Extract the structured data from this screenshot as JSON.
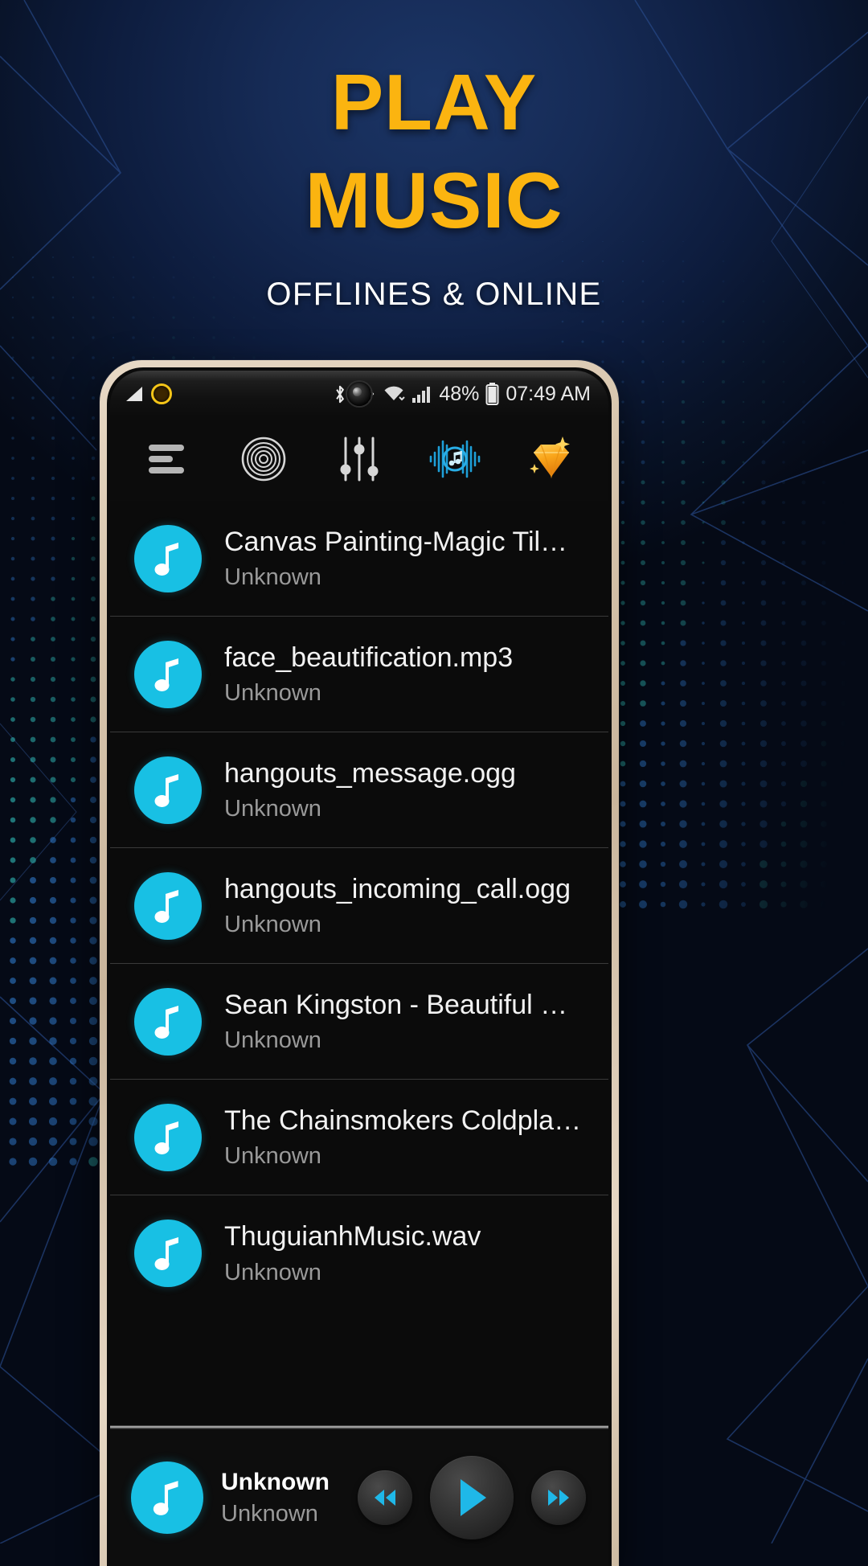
{
  "promo": {
    "headline_line1": "PLAY",
    "headline_line2": "MUSIC",
    "subtitle": "OFFLINES & ONLINE",
    "headline_color": "#FBB410",
    "subtitle_color": "#FFFFFF",
    "background_color": "#0d1c3d"
  },
  "phone": {
    "statusbar": {
      "signal_icon": "signal-triangle-icon",
      "notification_icon": "yellow-circle-icon",
      "camera": "front-camera-punchhole",
      "bluetooth_icon": "bluetooth-icon",
      "mute_icon": "mute-vibrate-icon",
      "wifi_icon": "wifi-icon",
      "cellular_icon": "cellular-bars-icon",
      "battery_percent": "48%",
      "battery_icon": "battery-icon",
      "time": "07:49 AM"
    },
    "toolbar": {
      "items": [
        {
          "name": "menu",
          "icon": "hamburger-menu-icon",
          "color": "#b5b5b5"
        },
        {
          "name": "disc",
          "icon": "vinyl-disc-icon",
          "color": "#d6d6d6"
        },
        {
          "name": "equalizer",
          "icon": "equalizer-sliders-icon",
          "color": "#d6d6d6"
        },
        {
          "name": "visualizer",
          "icon": "audio-waveform-music-icon",
          "color": "#22A9E0"
        },
        {
          "name": "premium",
          "icon": "diamond-gem-icon",
          "color": "#F9A51A"
        }
      ]
    },
    "tracks": [
      {
        "title": "Canvas Painting-Magic Til…",
        "artist": "Unknown"
      },
      {
        "title": "face_beautification.mp3",
        "artist": "Unknown"
      },
      {
        "title": "hangouts_message.ogg",
        "artist": "Unknown"
      },
      {
        "title": "hangouts_incoming_call.ogg",
        "artist": "Unknown"
      },
      {
        "title": "Sean Kingston - Beautiful …",
        "artist": "Unknown"
      },
      {
        "title": "The Chainsmokers  Coldpla…",
        "artist": "Unknown"
      },
      {
        "title": "ThuguianhMusic.wav",
        "artist": "Unknown"
      }
    ],
    "player": {
      "title": "Unknown",
      "artist": "Unknown",
      "previous_icon": "rewind-icon",
      "play_icon": "play-icon",
      "next_icon": "fast-forward-icon",
      "accent_color": "#18C0E4"
    },
    "accent_color": "#18C0E4",
    "bezel_color": "#d8c6ae"
  }
}
